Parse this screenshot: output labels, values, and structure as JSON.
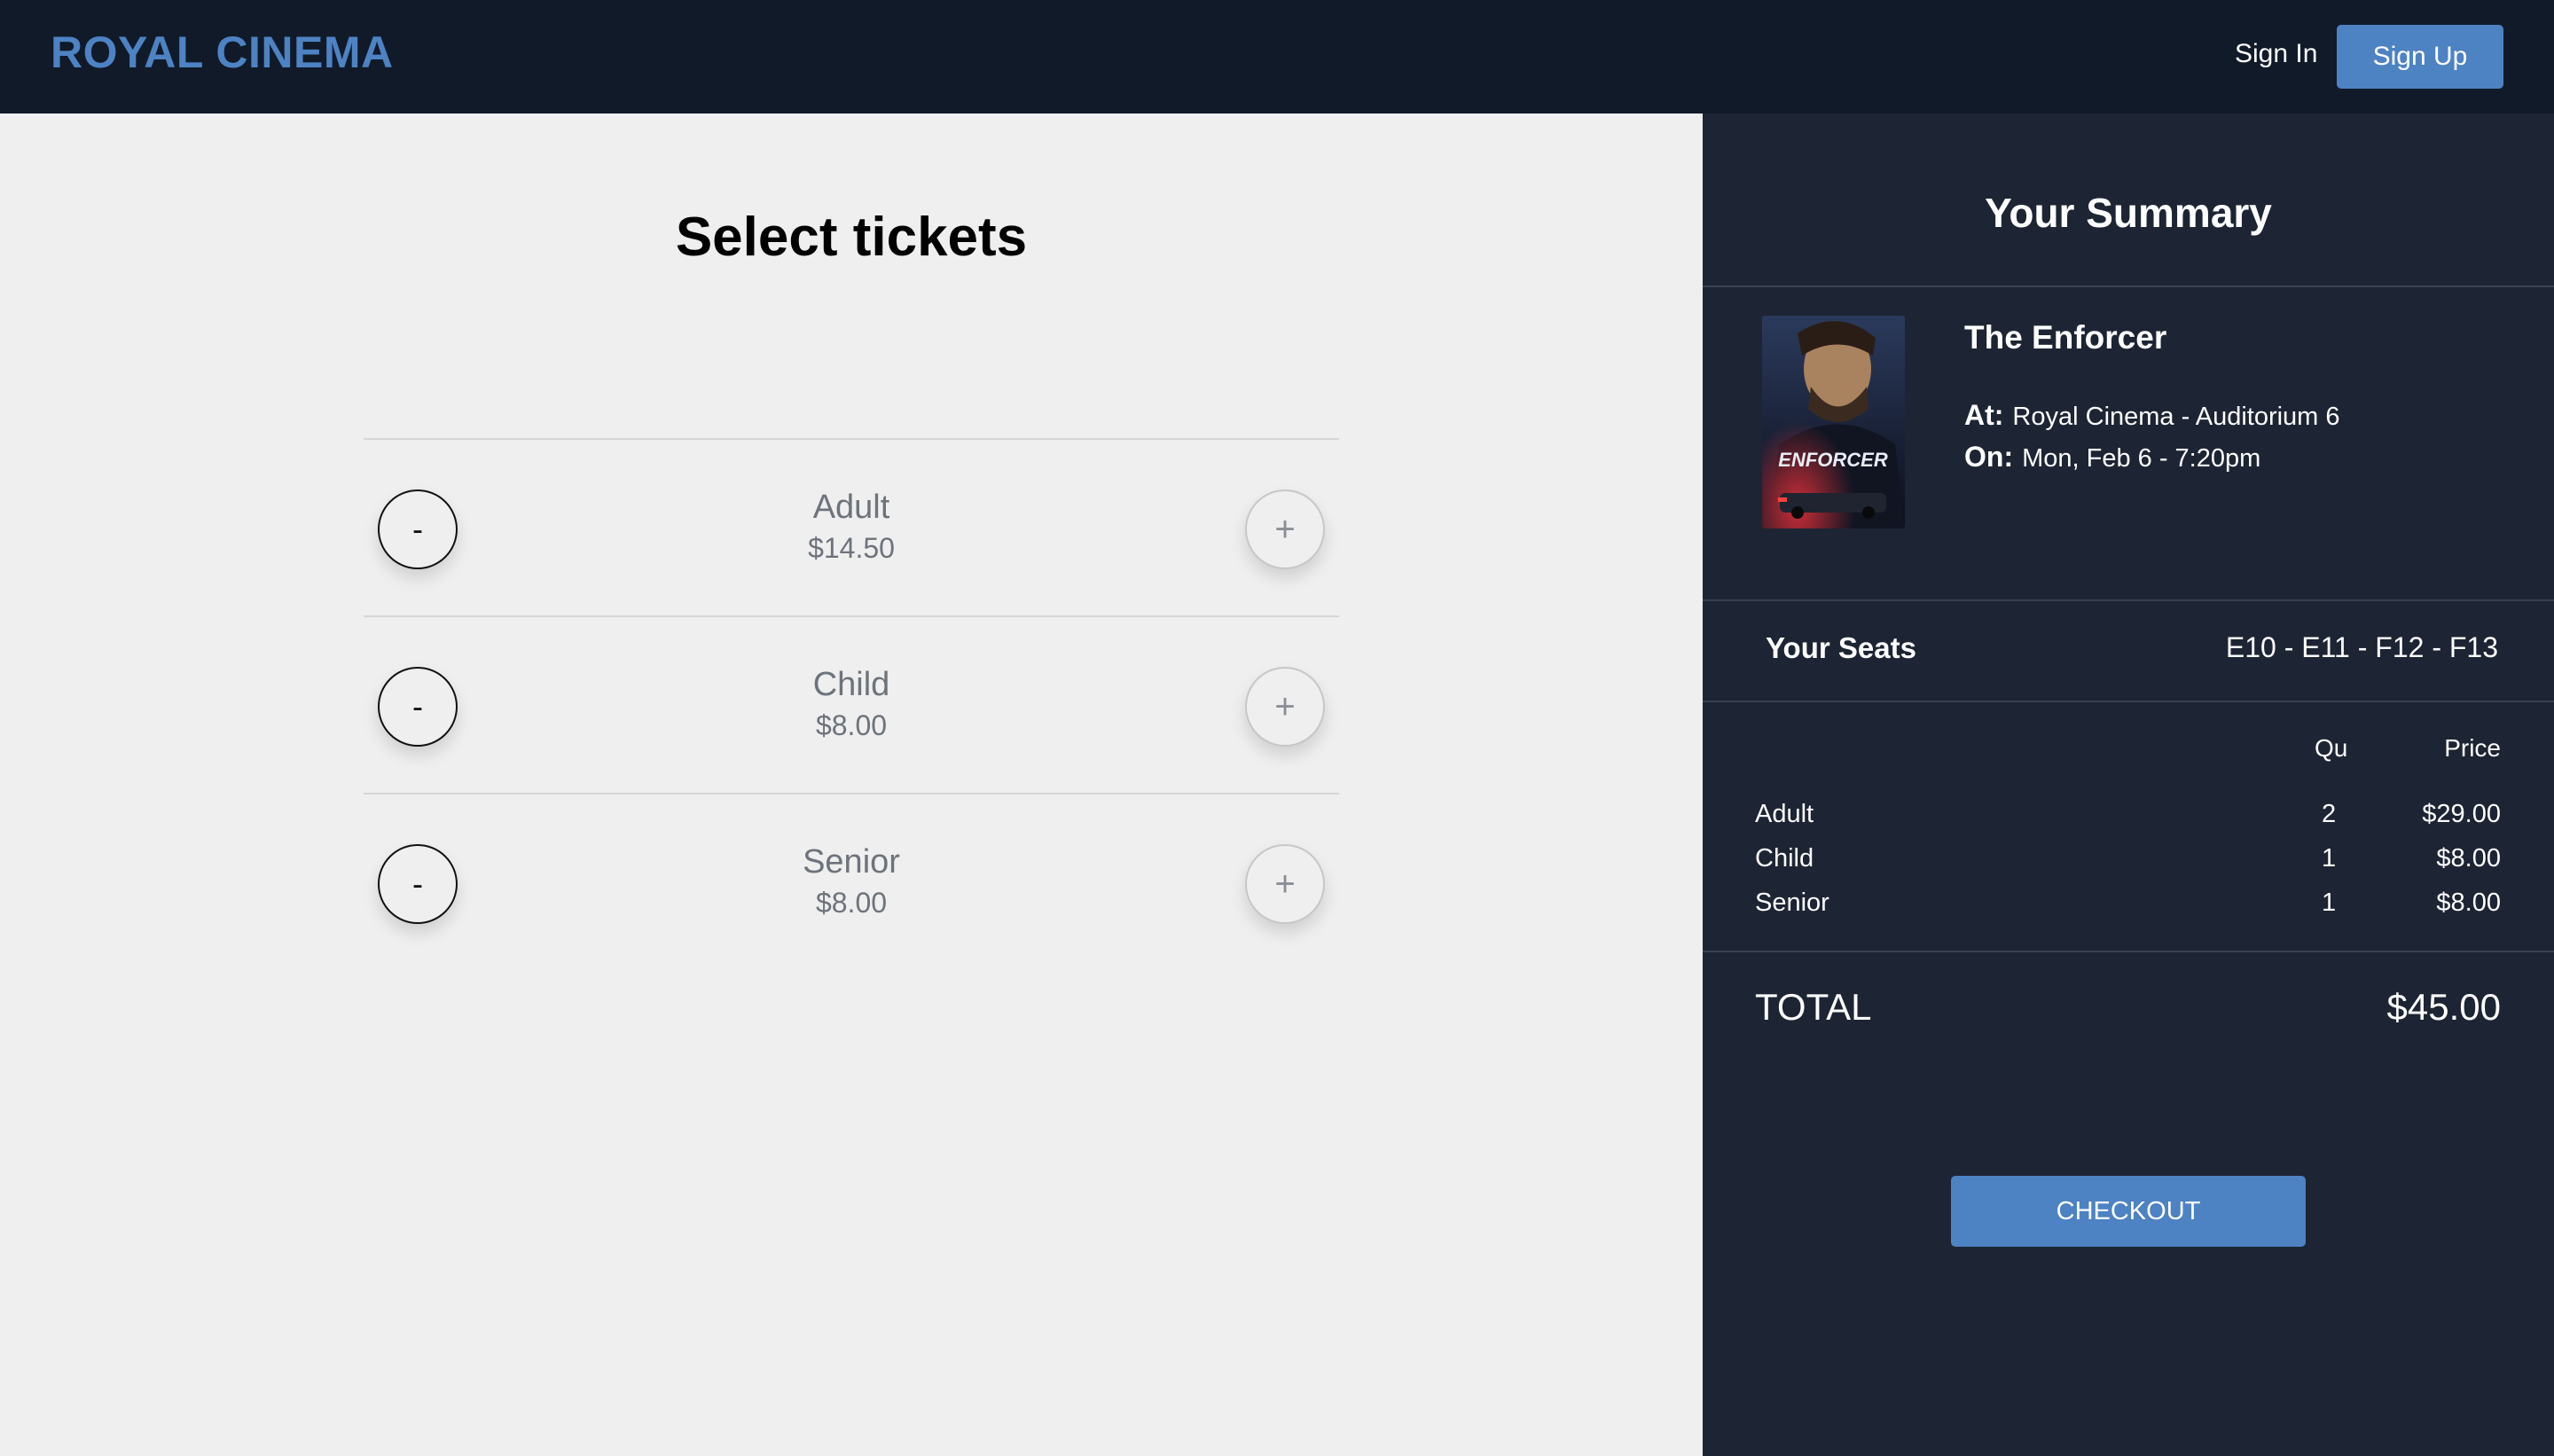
{
  "header": {
    "brand": "ROYAL CINEMA",
    "sign_in": "Sign In",
    "sign_up": "Sign Up"
  },
  "tickets": {
    "title": "Select tickets",
    "minus_label": "-",
    "plus_label": "+",
    "items": [
      {
        "name": "Adult",
        "price": "$14.50"
      },
      {
        "name": "Child",
        "price": "$8.00"
      },
      {
        "name": "Senior",
        "price": "$8.00"
      }
    ]
  },
  "summary": {
    "title": "Your Summary",
    "movie_title": "The Enforcer",
    "poster_text": "ENFORCER",
    "at_label": "At:",
    "at_value": "Royal Cinema - Auditorium 6",
    "on_label": "On:",
    "on_value": "Mon, Feb 6 - 7:20pm",
    "seats_label": "Your Seats",
    "seats_value": "E10 - E11 - F12 - F13",
    "qty_header": "Qu",
    "price_header": "Price",
    "lines": [
      {
        "name": "Adult",
        "qty": "2",
        "price": "$29.00"
      },
      {
        "name": "Child",
        "qty": "1",
        "price": "$8.00"
      },
      {
        "name": "Senior",
        "qty": "1",
        "price": "$8.00"
      }
    ],
    "total_label": "TOTAL",
    "total_value": "$45.00",
    "checkout_label": "CHECKOUT"
  },
  "colors": {
    "header_bg": "#111a29",
    "accent": "#4d82c3",
    "panel_bg": "#1d2433",
    "page_bg": "#efefef"
  }
}
